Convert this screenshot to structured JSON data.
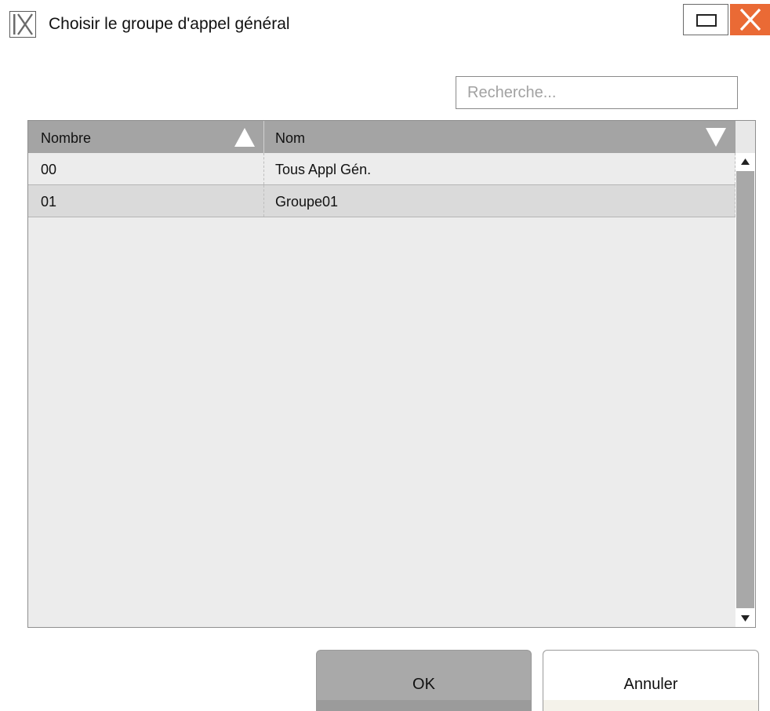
{
  "window": {
    "title": "Choisir le groupe d'appel général",
    "logo_icon": "ix-logo-icon",
    "maximize_icon": "maximize-icon",
    "close_icon": "close-icon",
    "close_color": "#ea6a35"
  },
  "search": {
    "placeholder": "Recherche...",
    "value": ""
  },
  "table": {
    "columns": [
      {
        "label": "Nombre",
        "sort_icon": "sort-ascending-icon"
      },
      {
        "label": "Nom",
        "sort_icon": "sort-descending-icon"
      }
    ],
    "rows": [
      {
        "number": "00",
        "name": "Tous Appl Gén."
      },
      {
        "number": "01",
        "name": "Groupe01"
      }
    ],
    "scroll_up_icon": "scroll-up-arrow-icon",
    "scroll_down_icon": "scroll-down-arrow-icon"
  },
  "buttons": {
    "ok_label": "OK",
    "cancel_label": "Annuler"
  }
}
